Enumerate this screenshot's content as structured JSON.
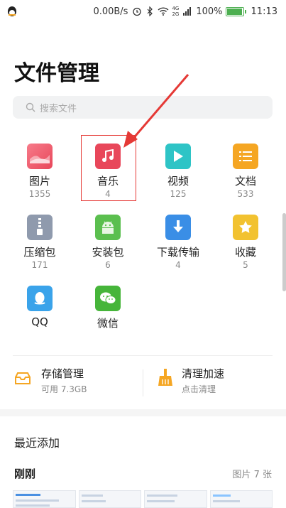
{
  "status_bar": {
    "net_speed": "0.00B/s",
    "net_top": "4G",
    "net_bottom": "2G",
    "battery": "100%",
    "battery_level": 1.0,
    "time": "11:13"
  },
  "header": {
    "title": "文件管理"
  },
  "search": {
    "placeholder": "搜索文件"
  },
  "categories": [
    {
      "label": "图片",
      "count": "1355",
      "icon": "image-icon",
      "color": "#ef5a6f"
    },
    {
      "label": "音乐",
      "count": "4",
      "icon": "music-note-icon",
      "color": "#e8475a"
    },
    {
      "label": "视频",
      "count": "125",
      "icon": "play-icon",
      "color": "#2ec4c6"
    },
    {
      "label": "文档",
      "count": "533",
      "icon": "document-icon",
      "color": "#f5a623"
    },
    {
      "label": "压缩包",
      "count": "171",
      "icon": "zip-icon",
      "color": "#8f9aad"
    },
    {
      "label": "安装包",
      "count": "6",
      "icon": "android-icon",
      "color": "#5bbf4f"
    },
    {
      "label": "下载传输",
      "count": "4",
      "icon": "download-icon",
      "color": "#3a8ee6"
    },
    {
      "label": "收藏",
      "count": "5",
      "icon": "star-icon",
      "color": "#f2c230"
    },
    {
      "label": "QQ",
      "count": "",
      "icon": "qq-icon",
      "color": "#3aa3ea"
    },
    {
      "label": "微信",
      "count": "",
      "icon": "wechat-icon",
      "color": "#46b53a"
    }
  ],
  "storage": {
    "title": "存储管理",
    "subtitle": "可用 7.3GB",
    "icon": "storage-tray-icon"
  },
  "cleanup": {
    "title": "清理加速",
    "subtitle": "点击清理",
    "icon": "broom-icon"
  },
  "recent": {
    "title": "最近添加",
    "group_title": "刚刚",
    "count_label": "图片 7 张"
  },
  "colors": {
    "accent": "#f5a623",
    "highlight": "#e53935"
  }
}
